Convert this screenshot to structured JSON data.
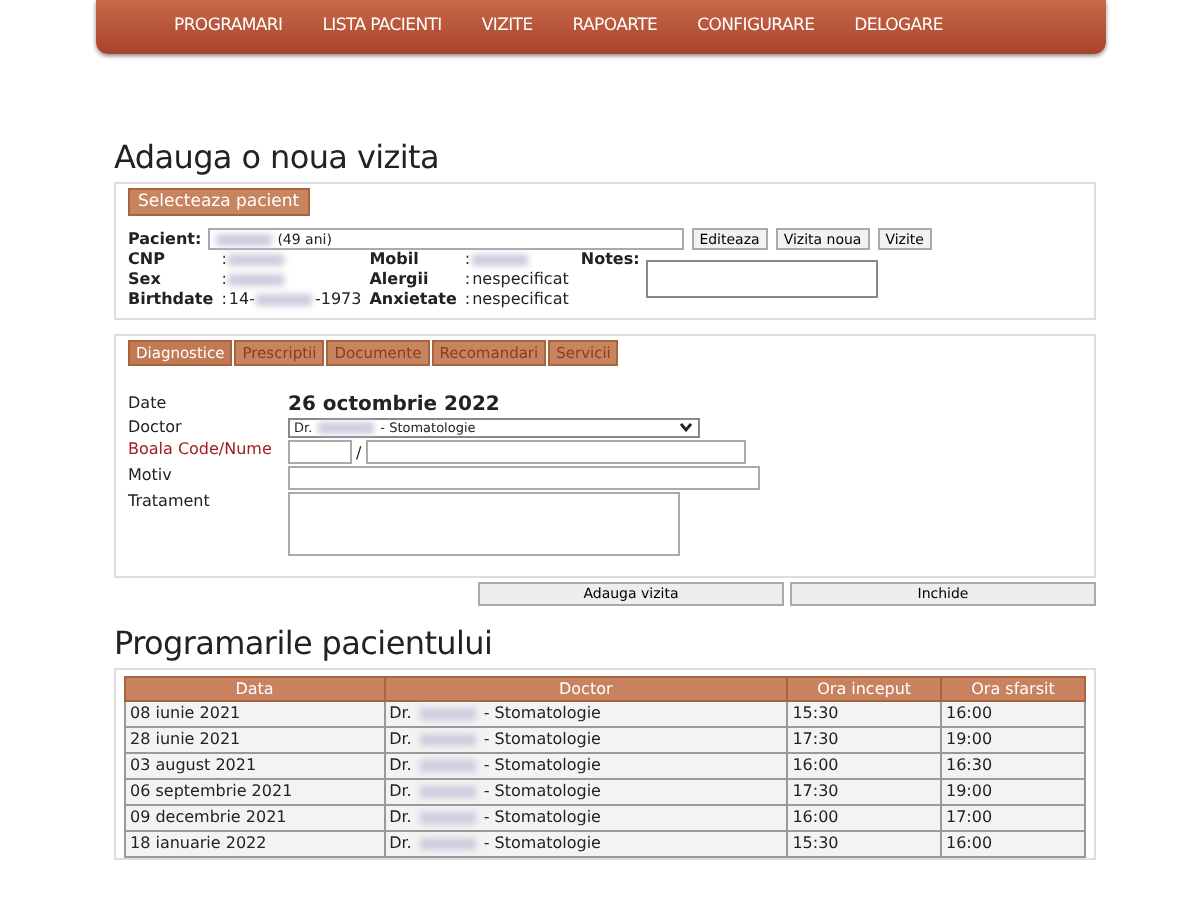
{
  "nav": [
    {
      "label": "PROGRAMARI"
    },
    {
      "label": "LISTA PACIENTI"
    },
    {
      "label": "VIZITE"
    },
    {
      "label": "RAPOARTE"
    },
    {
      "label": "CONFIGURARE"
    },
    {
      "label": "DELOGARE"
    }
  ],
  "page_title": "Adauga o noua vizita",
  "patient_panel": {
    "legend": "Selecteaza pacient",
    "patient_label": "Pacient:",
    "patient_value": [
      {
        "kind": "redacted"
      },
      {
        "kind": "text",
        "text": "(49 ani)"
      }
    ],
    "buttons": [
      "Editeaza",
      "Vizita noua",
      "Vizite"
    ],
    "fields": [
      {
        "label": "CNP",
        "value": [
          {
            "kind": "redacted"
          }
        ]
      },
      {
        "label": "Mobil",
        "value": [
          {
            "kind": "redacted"
          }
        ]
      },
      {
        "label": "Sex",
        "value": [
          {
            "kind": "redacted"
          }
        ]
      },
      {
        "label": "Alergii",
        "value": [
          {
            "kind": "text",
            "text": "nespecificat"
          }
        ]
      },
      {
        "label": "Birthdate",
        "value": [
          {
            "kind": "text",
            "text": "14-"
          },
          {
            "kind": "redacted"
          },
          {
            "kind": "text",
            "text": "-1973"
          }
        ]
      },
      {
        "label": "Anxietate",
        "value": [
          {
            "kind": "text",
            "text": "nespecificat"
          }
        ]
      }
    ],
    "separator": ":",
    "notes_label": "Notes:"
  },
  "tabs": [
    {
      "label": "Diagnostice",
      "selected": true
    },
    {
      "label": "Prescriptii",
      "selected": false
    },
    {
      "label": "Documente",
      "selected": false
    },
    {
      "label": "Recomandari",
      "selected": false
    },
    {
      "label": "Servicii",
      "selected": false
    }
  ],
  "form": [
    {
      "kind": "date",
      "label": "Date",
      "required": false,
      "value": "26 octombrie 2022"
    },
    {
      "kind": "select",
      "label": "Doctor",
      "required": false,
      "value": [
        {
          "kind": "text",
          "text": "Dr."
        },
        {
          "kind": "redacted"
        },
        {
          "kind": "text",
          "text": "- Stomatologie"
        }
      ]
    },
    {
      "kind": "code",
      "label": "Boala Code/Nume",
      "required": true,
      "separator": "/"
    },
    {
      "kind": "input",
      "label": "Motiv",
      "required": false
    },
    {
      "kind": "textarea",
      "label": "Tratament",
      "required": false
    }
  ],
  "actions": [
    "Adauga vizita",
    "Inchide"
  ],
  "appointments_title": "Programarile pacientului",
  "table": {
    "columns": [
      "Data",
      "Doctor",
      "Ora inceput",
      "Ora sfarsit"
    ],
    "rows": [
      {
        "date": "08 iunie 2021",
        "doctor": [
          {
            "kind": "text",
            "text": "Dr."
          },
          {
            "kind": "redacted"
          },
          {
            "kind": "text",
            "text": "- Stomatologie"
          }
        ],
        "start": "15:30",
        "end": "16:00"
      },
      {
        "date": "28 iunie 2021",
        "doctor": [
          {
            "kind": "text",
            "text": "Dr."
          },
          {
            "kind": "redacted"
          },
          {
            "kind": "text",
            "text": "- Stomatologie"
          }
        ],
        "start": "17:30",
        "end": "19:00"
      },
      {
        "date": "03 august 2021",
        "doctor": [
          {
            "kind": "text",
            "text": "Dr."
          },
          {
            "kind": "redacted"
          },
          {
            "kind": "text",
            "text": "- Stomatologie"
          }
        ],
        "start": "16:00",
        "end": "16:30"
      },
      {
        "date": "06 septembrie 2021",
        "doctor": [
          {
            "kind": "text",
            "text": "Dr."
          },
          {
            "kind": "redacted"
          },
          {
            "kind": "text",
            "text": "- Stomatologie"
          }
        ],
        "start": "17:30",
        "end": "19:00"
      },
      {
        "date": "09 decembrie 2021",
        "doctor": [
          {
            "kind": "text",
            "text": "Dr."
          },
          {
            "kind": "redacted"
          },
          {
            "kind": "text",
            "text": "- Stomatologie"
          }
        ],
        "start": "16:00",
        "end": "17:00"
      },
      {
        "date": "18 ianuarie 2022",
        "doctor": [
          {
            "kind": "text",
            "text": "Dr."
          },
          {
            "kind": "redacted"
          },
          {
            "kind": "text",
            "text": "- Stomatologie"
          }
        ],
        "start": "15:30",
        "end": "16:00"
      }
    ]
  }
}
